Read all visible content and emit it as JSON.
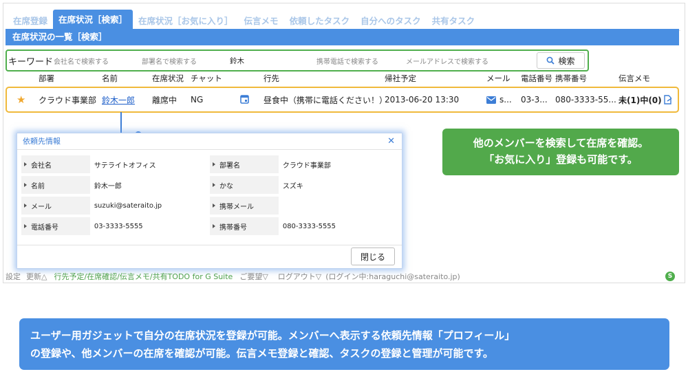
{
  "tabs": [
    {
      "label": "在席登録"
    },
    {
      "label": "在席状況［検索］"
    },
    {
      "label": "在席状況［お気に入り］"
    },
    {
      "label": "伝言メモ"
    },
    {
      "label": "依頼したタスク"
    },
    {
      "label": "自分へのタスク"
    },
    {
      "label": "共有タスク"
    }
  ],
  "panel": {
    "title": "在席状況の一覧［検索］"
  },
  "search": {
    "label": "キーワード",
    "company_ph": "会社名で検索する",
    "dept_ph": "部署名で検索する",
    "name_value": "鈴木",
    "mobile_ph": "携帯電話で検索する",
    "mail_ph": "メールアドレスで検索する",
    "button": "検索"
  },
  "columns": [
    "部署",
    "名前",
    "在席状況",
    "チャット",
    "行先",
    "帰社予定",
    "メール",
    "電話番号",
    "携帯番号",
    "伝言メモ"
  ],
  "row": {
    "dept": "クラウド事業部",
    "name": "鈴木一郎",
    "status": "離席中",
    "chat": "NG",
    "destination": "昼食中（携帯に電話ください！）",
    "return": "2013-06-20 13:30",
    "mail": "s...",
    "phone": "03-3...",
    "mobile": "080-3333-55...",
    "memo": "未(1)中(0)"
  },
  "modal": {
    "title": "依頼先情報",
    "fields": [
      {
        "l1": "会社名",
        "v1": "サテライトオフィス",
        "l2": "部署名",
        "v2": "クラウド事業部"
      },
      {
        "l1": "名前",
        "v1": "鈴木一郎",
        "l2": "かな",
        "v2": "スズキ"
      },
      {
        "l1": "メール",
        "v1": "suzuki@sateraito.jp",
        "l2": "携帯メール",
        "v2": ""
      },
      {
        "l1": "電話番号",
        "v1": "03-3333-5555",
        "l2": "携帯番号",
        "v2": "080-3333-5555"
      }
    ],
    "close_button": "閉じる"
  },
  "footer": {
    "settings": "設定",
    "update": "更新△",
    "product": "行先予定/在席確認/伝言メモ/共有TODO for G Suite",
    "request": "ご要望▽",
    "logout": "ログアウト▽",
    "login_info": "(ログイン中:haraguchi@sateraito.jp)",
    "badge": "S"
  },
  "callouts": {
    "green": [
      "他のメンバーを検索して在席を確認。",
      "「お気に入り」登録も可能です。"
    ],
    "blue": [
      "ユーザー用ガジェットで自分の在席状況を登録が可能。メンバーへ表示する依頼先情報「プロフィール」",
      "の登録や、他メンバーの在席を確認が可能。伝言メモ登録と確認、タスクの登録と管理が可能です。"
    ]
  },
  "colors": {
    "accent": "#4a8fe2",
    "green": "#52a94b",
    "highlight": "#f0b93a"
  }
}
